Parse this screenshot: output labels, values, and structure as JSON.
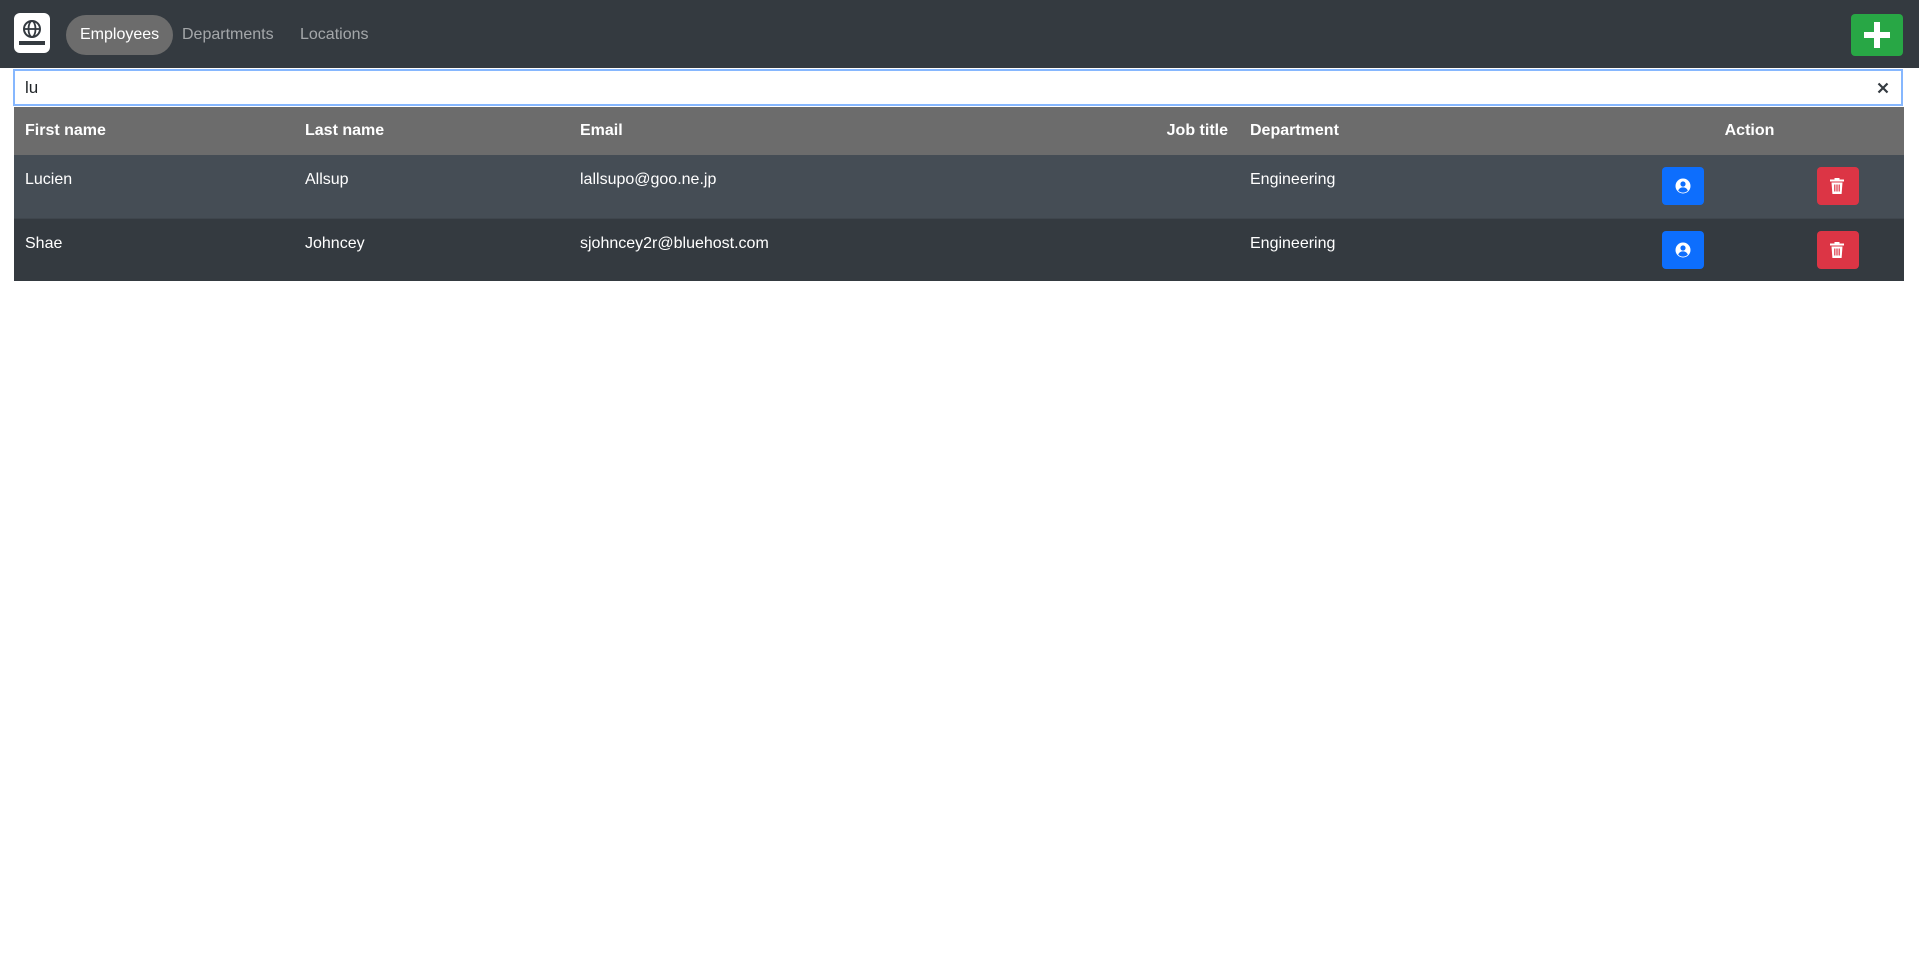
{
  "nav": {
    "brand_icon": "globe-book-icon",
    "tabs": [
      {
        "label": "Employees",
        "active": true
      },
      {
        "label": "Departments",
        "active": false
      },
      {
        "label": "Locations",
        "active": false
      }
    ],
    "add_icon": "plus-icon",
    "add_color": "#28a745"
  },
  "search": {
    "value": "lu",
    "clear_icon": "close-icon"
  },
  "table": {
    "headers": {
      "first_name": "First name",
      "last_name": "Last name",
      "email": "Email",
      "job_title": "Job title",
      "department": "Department",
      "action": "Action"
    },
    "rows": [
      {
        "first_name": "Lucien",
        "last_name": "Allsup",
        "email": "lallsupo@goo.ne.jp",
        "job_title": "",
        "department": "Engineering"
      },
      {
        "first_name": "Shae",
        "last_name": "Johncey",
        "email": "sjohncey2r@bluehost.com",
        "job_title": "",
        "department": "Engineering"
      }
    ],
    "view_icon": "user-circle-icon",
    "delete_icon": "trash-icon",
    "view_color": "#0d6efd",
    "delete_color": "#dc3545"
  }
}
